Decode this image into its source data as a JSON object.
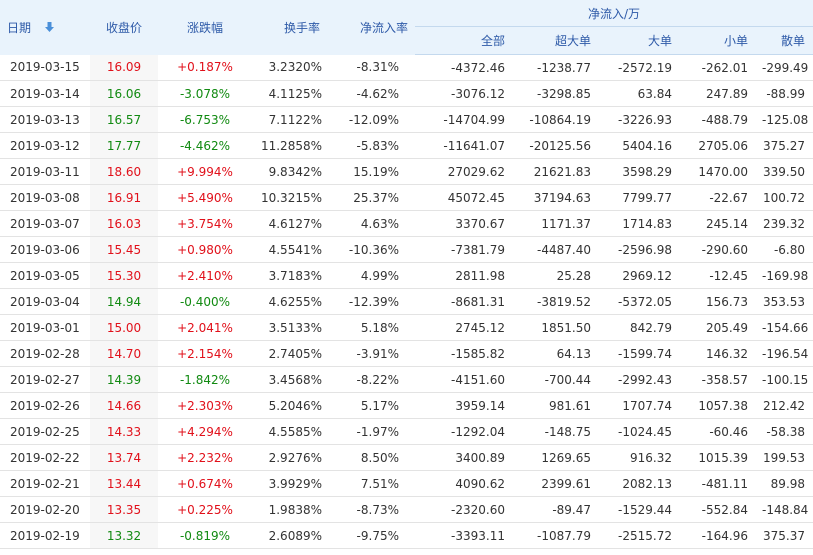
{
  "colors": {
    "up": "#e1101a",
    "down": "#118a11",
    "header_bg": "#e9f3fc",
    "header_text": "#2e5aa8"
  },
  "headers": {
    "date": "日期",
    "sort_icon": "arrow-down-icon",
    "close": "收盘价",
    "change": "涨跌幅",
    "turnover": "换手率",
    "net_rate": "净流入率",
    "net_group": "净流入/万",
    "all": "全部",
    "super_large": "超大单",
    "large": "大单",
    "small": "小单",
    "retail": "散单"
  },
  "rows": [
    {
      "date": "2019-03-15",
      "close": "16.09",
      "change": "+0.187%",
      "turnover": "3.2320%",
      "net_rate": "-8.31%",
      "all": "-4372.46",
      "super_large": "-1238.77",
      "large": "-2572.19",
      "small": "-262.01",
      "retail": "-299.49",
      "dir": "up"
    },
    {
      "date": "2019-03-14",
      "close": "16.06",
      "change": "-3.078%",
      "turnover": "4.1125%",
      "net_rate": "-4.62%",
      "all": "-3076.12",
      "super_large": "-3298.85",
      "large": "63.84",
      "small": "247.89",
      "retail": "-88.99",
      "dir": "down"
    },
    {
      "date": "2019-03-13",
      "close": "16.57",
      "change": "-6.753%",
      "turnover": "7.1122%",
      "net_rate": "-12.09%",
      "all": "-14704.99",
      "super_large": "-10864.19",
      "large": "-3226.93",
      "small": "-488.79",
      "retail": "-125.08",
      "dir": "down"
    },
    {
      "date": "2019-03-12",
      "close": "17.77",
      "change": "-4.462%",
      "turnover": "11.2858%",
      "net_rate": "-5.83%",
      "all": "-11641.07",
      "super_large": "-20125.56",
      "large": "5404.16",
      "small": "2705.06",
      "retail": "375.27",
      "dir": "down"
    },
    {
      "date": "2019-03-11",
      "close": "18.60",
      "change": "+9.994%",
      "turnover": "9.8342%",
      "net_rate": "15.19%",
      "all": "27029.62",
      "super_large": "21621.83",
      "large": "3598.29",
      "small": "1470.00",
      "retail": "339.50",
      "dir": "up"
    },
    {
      "date": "2019-03-08",
      "close": "16.91",
      "change": "+5.490%",
      "turnover": "10.3215%",
      "net_rate": "25.37%",
      "all": "45072.45",
      "super_large": "37194.63",
      "large": "7799.77",
      "small": "-22.67",
      "retail": "100.72",
      "dir": "up"
    },
    {
      "date": "2019-03-07",
      "close": "16.03",
      "change": "+3.754%",
      "turnover": "4.6127%",
      "net_rate": "4.63%",
      "all": "3370.67",
      "super_large": "1171.37",
      "large": "1714.83",
      "small": "245.14",
      "retail": "239.32",
      "dir": "up"
    },
    {
      "date": "2019-03-06",
      "close": "15.45",
      "change": "+0.980%",
      "turnover": "4.5541%",
      "net_rate": "-10.36%",
      "all": "-7381.79",
      "super_large": "-4487.40",
      "large": "-2596.98",
      "small": "-290.60",
      "retail": "-6.80",
      "dir": "up"
    },
    {
      "date": "2019-03-05",
      "close": "15.30",
      "change": "+2.410%",
      "turnover": "3.7183%",
      "net_rate": "4.99%",
      "all": "2811.98",
      "super_large": "25.28",
      "large": "2969.12",
      "small": "-12.45",
      "retail": "-169.98",
      "dir": "up"
    },
    {
      "date": "2019-03-04",
      "close": "14.94",
      "change": "-0.400%",
      "turnover": "4.6255%",
      "net_rate": "-12.39%",
      "all": "-8681.31",
      "super_large": "-3819.52",
      "large": "-5372.05",
      "small": "156.73",
      "retail": "353.53",
      "dir": "down"
    },
    {
      "date": "2019-03-01",
      "close": "15.00",
      "change": "+2.041%",
      "turnover": "3.5133%",
      "net_rate": "5.18%",
      "all": "2745.12",
      "super_large": "1851.50",
      "large": "842.79",
      "small": "205.49",
      "retail": "-154.66",
      "dir": "up"
    },
    {
      "date": "2019-02-28",
      "close": "14.70",
      "change": "+2.154%",
      "turnover": "2.7405%",
      "net_rate": "-3.91%",
      "all": "-1585.82",
      "super_large": "64.13",
      "large": "-1599.74",
      "small": "146.32",
      "retail": "-196.54",
      "dir": "up"
    },
    {
      "date": "2019-02-27",
      "close": "14.39",
      "change": "-1.842%",
      "turnover": "3.4568%",
      "net_rate": "-8.22%",
      "all": "-4151.60",
      "super_large": "-700.44",
      "large": "-2992.43",
      "small": "-358.57",
      "retail": "-100.15",
      "dir": "down"
    },
    {
      "date": "2019-02-26",
      "close": "14.66",
      "change": "+2.303%",
      "turnover": "5.2046%",
      "net_rate": "5.17%",
      "all": "3959.14",
      "super_large": "981.61",
      "large": "1707.74",
      "small": "1057.38",
      "retail": "212.42",
      "dir": "up"
    },
    {
      "date": "2019-02-25",
      "close": "14.33",
      "change": "+4.294%",
      "turnover": "4.5585%",
      "net_rate": "-1.97%",
      "all": "-1292.04",
      "super_large": "-148.75",
      "large": "-1024.45",
      "small": "-60.46",
      "retail": "-58.38",
      "dir": "up"
    },
    {
      "date": "2019-02-22",
      "close": "13.74",
      "change": "+2.232%",
      "turnover": "2.9276%",
      "net_rate": "8.50%",
      "all": "3400.89",
      "super_large": "1269.65",
      "large": "916.32",
      "small": "1015.39",
      "retail": "199.53",
      "dir": "up"
    },
    {
      "date": "2019-02-21",
      "close": "13.44",
      "change": "+0.674%",
      "turnover": "3.9929%",
      "net_rate": "7.51%",
      "all": "4090.62",
      "super_large": "2399.61",
      "large": "2082.13",
      "small": "-481.11",
      "retail": "89.98",
      "dir": "up"
    },
    {
      "date": "2019-02-20",
      "close": "13.35",
      "change": "+0.225%",
      "turnover": "1.9838%",
      "net_rate": "-8.73%",
      "all": "-2320.60",
      "super_large": "-89.47",
      "large": "-1529.44",
      "small": "-552.84",
      "retail": "-148.84",
      "dir": "up"
    },
    {
      "date": "2019-02-19",
      "close": "13.32",
      "change": "-0.819%",
      "turnover": "2.6089%",
      "net_rate": "-9.75%",
      "all": "-3393.11",
      "super_large": "-1087.79",
      "large": "-2515.72",
      "small": "-164.96",
      "retail": "375.37",
      "dir": "down"
    }
  ]
}
